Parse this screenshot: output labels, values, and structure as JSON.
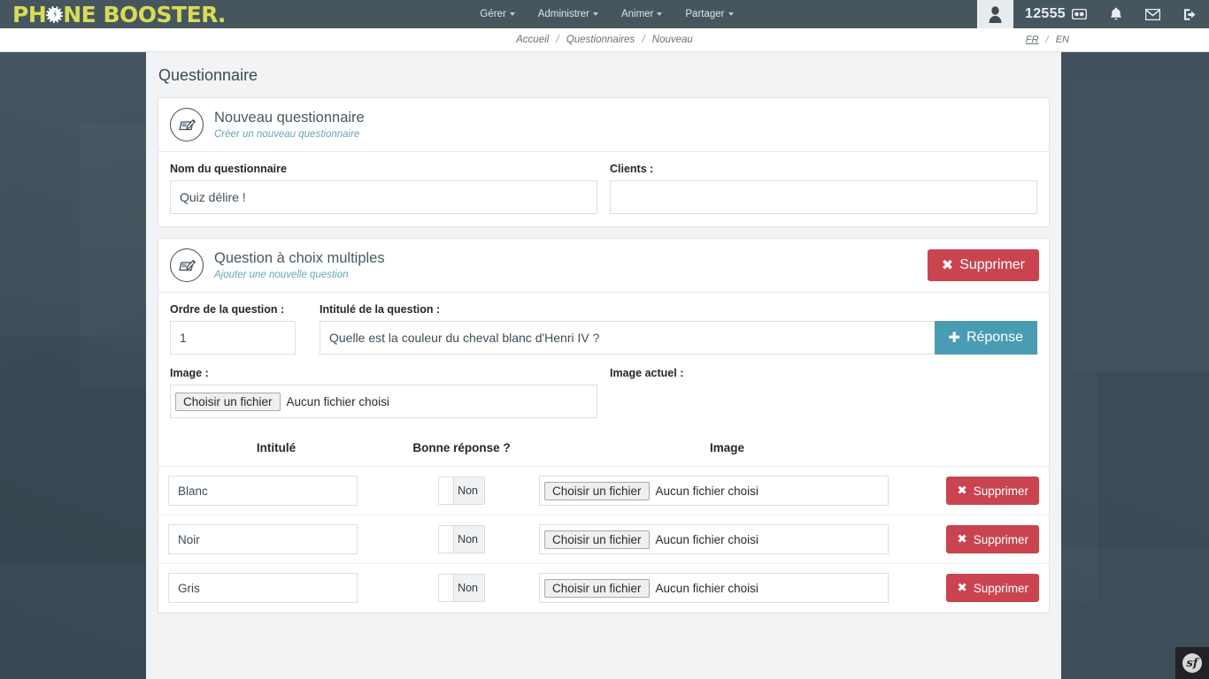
{
  "brand": {
    "logo_text_1": "PH",
    "logo_text_2": "NE BOOSTER",
    "logo_dot": ".",
    "logo_color": "#d9dc57"
  },
  "topnav": {
    "items": [
      {
        "label": "Gérer"
      },
      {
        "label": "Administrer"
      },
      {
        "label": "Animer"
      },
      {
        "label": "Partager"
      }
    ]
  },
  "topright": {
    "credits": "12555",
    "avatar_glyph": "♟",
    "bell_glyph": "🔔",
    "mail_glyph": "✉",
    "logout_glyph": "→"
  },
  "breadcrumb": {
    "items": [
      "Accueil",
      "Questionnaires",
      "Nouveau"
    ],
    "separator": "/"
  },
  "language": {
    "fr": "FR",
    "en": "EN",
    "separator": "/",
    "active": "FR"
  },
  "page": {
    "title": "Questionnaire"
  },
  "questionnaire_card": {
    "title": "Nouveau questionnaire",
    "subtitle": "Créer un nouveau questionnaire",
    "name_label": "Nom du questionnaire",
    "name_value": "Quiz délire !",
    "clients_label": "Clients :",
    "clients_value": ""
  },
  "question_card": {
    "title": "Question à choix multiples",
    "subtitle": "Ajouter une nouvelle question",
    "delete_label": "Supprimer",
    "delete_icon": "✖",
    "order_label": "Ordre de la question :",
    "order_value": "1",
    "intitule_label": "Intitulé de la question :",
    "intitule_value": "Quelle est la couleur du cheval blanc d'Henri IV ?",
    "reponse_label": "Réponse",
    "reponse_icon": "✚",
    "image_label": "Image :",
    "image_actuel_label": "Image actuel :",
    "file_button": "Choisir un fichier",
    "file_status": "Aucun fichier choisi"
  },
  "answers_table": {
    "columns": [
      "Intitulé",
      "Bonne réponse ?",
      "Image"
    ],
    "rows": [
      {
        "intitule": "Blanc",
        "bonne_reponse": "Non",
        "file_button": "Choisir un fichier",
        "file_status": "Aucun fichier choisi",
        "delete_label": "Supprimer",
        "delete_icon": "✖"
      },
      {
        "intitule": "Noir",
        "bonne_reponse": "Non",
        "file_button": "Choisir un fichier",
        "file_status": "Aucun fichier choisi",
        "delete_label": "Supprimer",
        "delete_icon": "✖"
      },
      {
        "intitule": "Gris",
        "bonne_reponse": "Non",
        "file_button": "Choisir un fichier",
        "file_status": "Aucun fichier choisi",
        "delete_label": "Supprimer",
        "delete_icon": "✖"
      }
    ]
  },
  "debug_toolbar": {
    "label": "sf"
  },
  "colors": {
    "danger": "#c9444f",
    "info": "#4a9cb5",
    "header_bg": "#46565f",
    "page_bg": "#3f505c",
    "accent_sub": "#62a8b5"
  }
}
